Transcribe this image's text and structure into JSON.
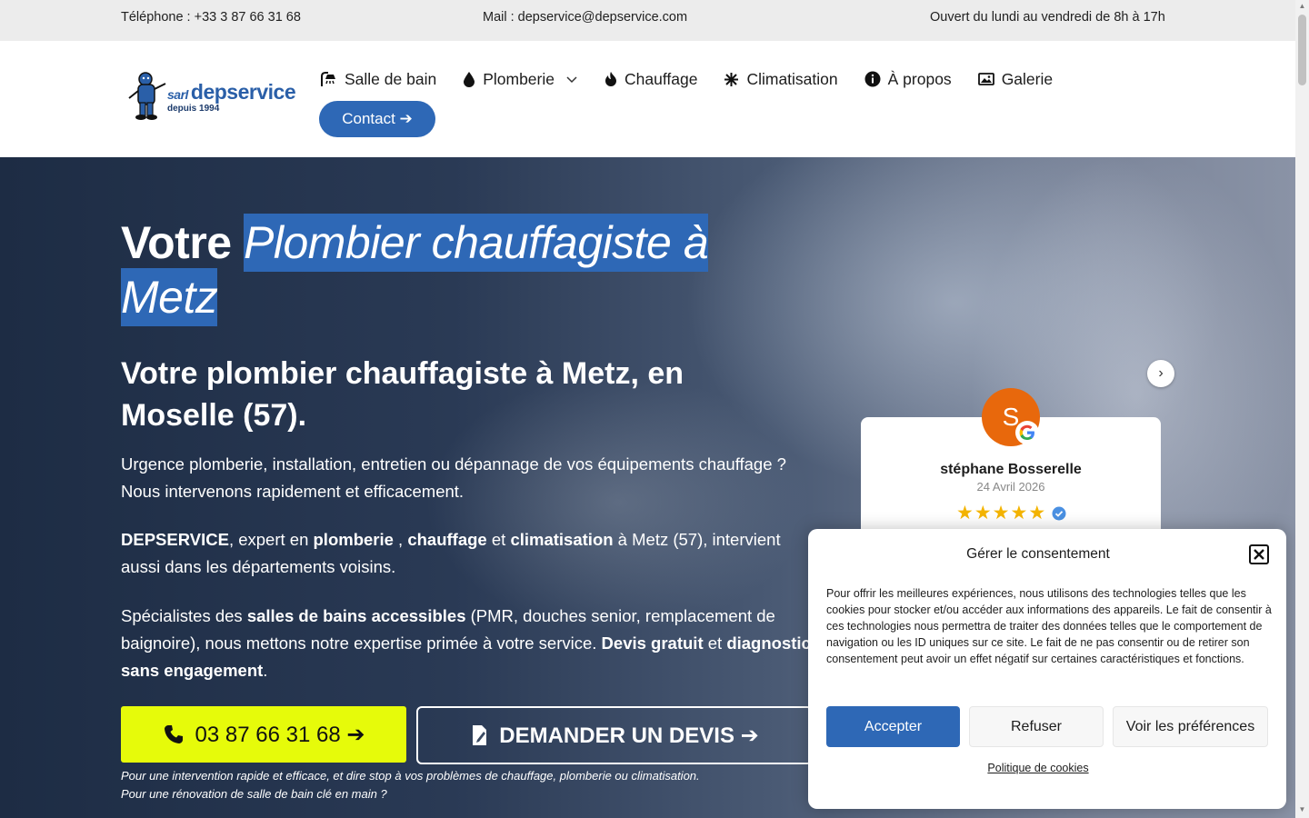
{
  "topbar": {
    "phone": "Téléphone : +33 3 87 66 31 68",
    "mail": "Mail : depservice@depservice.com",
    "hours": "Ouvert du lundi au vendredi de 8h à 17h"
  },
  "logo": {
    "sarl": "sarl",
    "name": "depservice",
    "tagline": "depuis 1994"
  },
  "nav": {
    "items": [
      {
        "label": "Salle de bain",
        "icon": "shower-icon"
      },
      {
        "label": "Plomberie",
        "icon": "drop-icon"
      },
      {
        "label": "Chauffage",
        "icon": "flame-icon"
      },
      {
        "label": "Climatisation",
        "icon": "snowflake-icon"
      },
      {
        "label": "À propos",
        "icon": "info-icon"
      },
      {
        "label": "Galerie",
        "icon": "image-icon"
      }
    ],
    "contact": "Contact ➔"
  },
  "hero": {
    "title_plain": "Votre ",
    "title_highlight": "Plombier chauffagiste à Metz",
    "subtitle": "Votre plombier chauffagiste à Metz, en Moselle (57).",
    "p1": "Urgence plomberie, installation, entretien ou dépannage de vos équipements chauffage ? Nous intervenons rapidement et efficacement.",
    "p2": {
      "b1": "DEPSERVICE",
      "t1": ", expert en ",
      "b2": "plomberie",
      "t2": " , ",
      "b3": "chauffage",
      "t3": " et ",
      "b4": "climatisation",
      "t4": " à Metz (57), intervient aussi dans les départements voisins."
    },
    "p3": {
      "t1": "Spécialistes des ",
      "b1": "salles de bains accessibles",
      "t2": " (PMR, douches senior, remplacement de baignoire), nous mettons notre expertise primée à votre service. ",
      "b2": "Devis gratuit",
      "t3": " et ",
      "b3": "diagnostic sans engagement",
      "t4": "."
    },
    "phone_button": "03 87 66 31 68 ➔",
    "devis_button": "DEMANDER UN DEVIS ➔",
    "note1": "Pour une intervention rapide et efficace, et dire stop à vos problèmes de chauffage, plomberie ou climatisation.",
    "note2": "Pour une rénovation de salle de bain clé en main ?"
  },
  "review": {
    "initial": "S",
    "name": "stéphane Bosserelle",
    "date": "24 Avril 2026",
    "rating": 5,
    "star_color": "#f4b400"
  },
  "consent": {
    "title": "Gérer le consentement",
    "text": "Pour offrir les meilleures expériences, nous utilisons des technologies telles que les cookies pour stocker et/ou accéder aux informations des appareils. Le fait de consentir à ces technologies nous permettra de traiter des données telles que le comportement de navigation ou les ID uniques sur ce site. Le fait de ne pas consentir ou de retirer son consentement peut avoir un effet négatif sur certaines caractéristiques et fonctions.",
    "accept": "Accepter",
    "refuse": "Refuser",
    "preferences": "Voir les préférences",
    "policy_link": "Politique de cookies"
  },
  "colors": {
    "brand_blue": "#2e68b6",
    "cta_yellow": "#e6fb0a",
    "avatar_orange": "#e8680c"
  }
}
